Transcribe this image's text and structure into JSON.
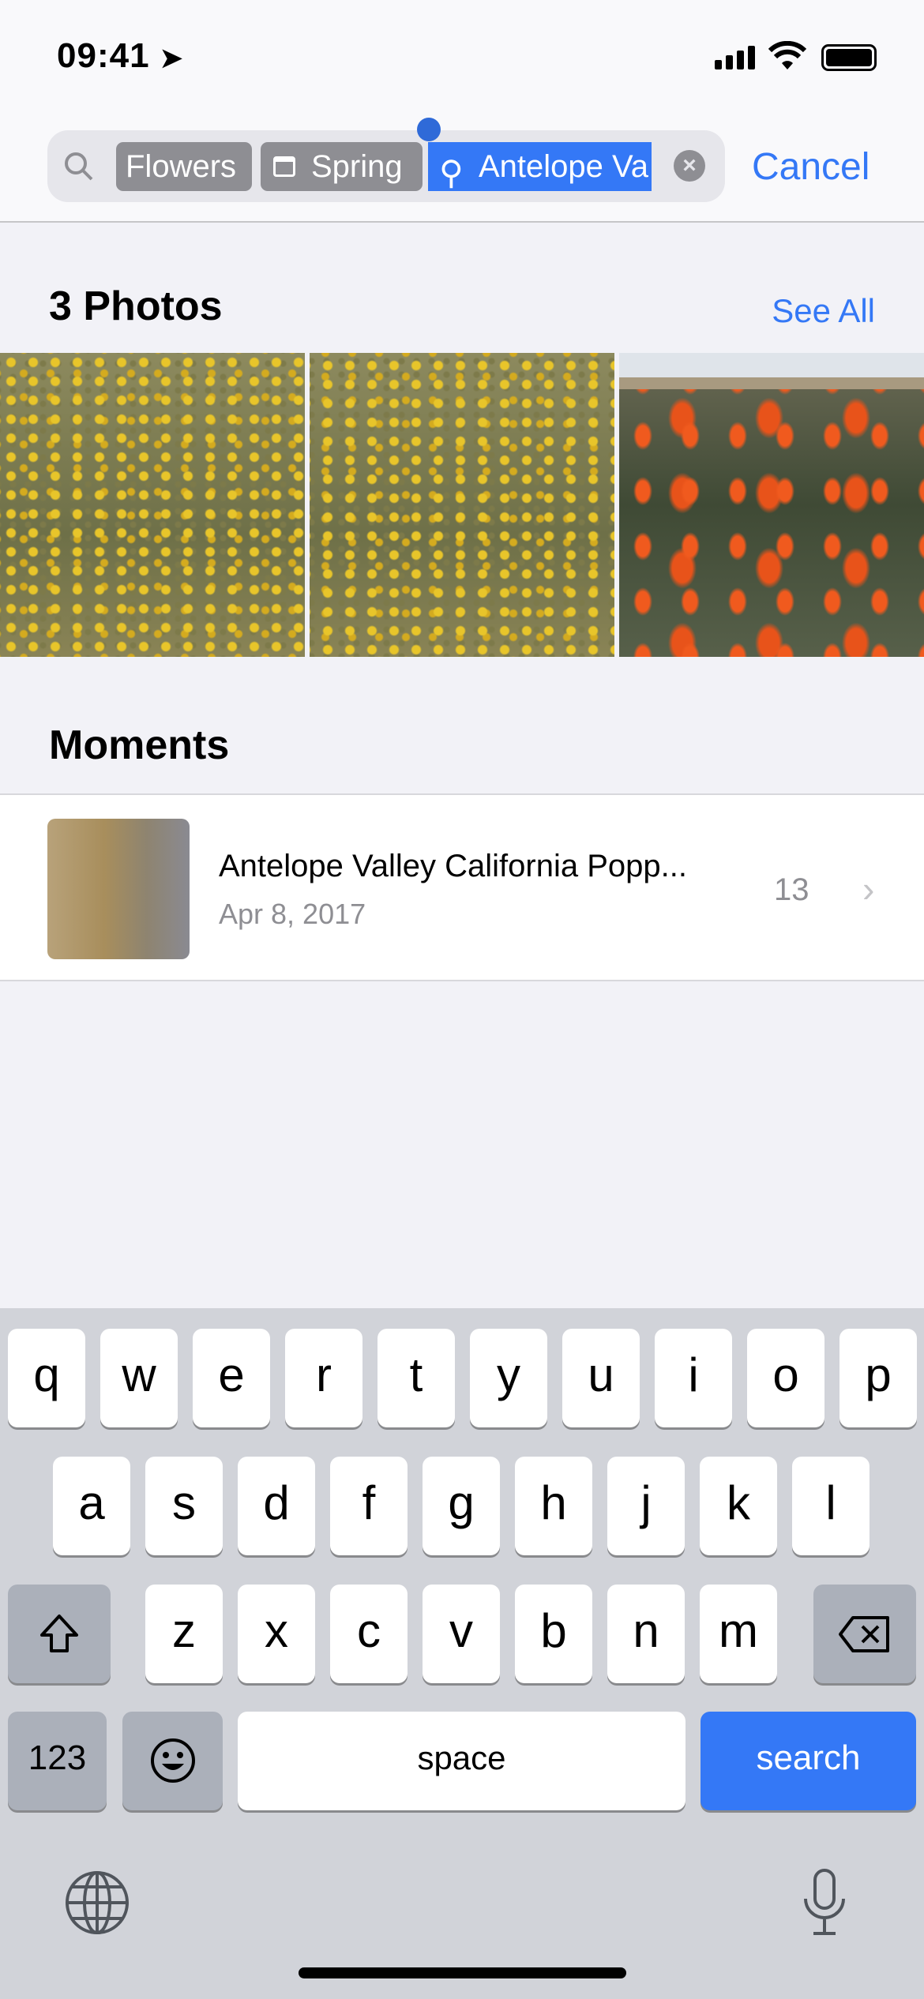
{
  "status_bar": {
    "time": "09:41"
  },
  "search": {
    "tokens": [
      {
        "label": "Flowers",
        "icon": "none"
      },
      {
        "label": "Spring",
        "icon": "calendar-icon"
      },
      {
        "label": "Antelope Va",
        "icon": "location-pin-icon",
        "selected": true
      }
    ],
    "cancel_label": "Cancel"
  },
  "photos": {
    "title": "3 Photos",
    "see_all": "See All",
    "count": 3
  },
  "moments": {
    "title": "Moments",
    "items": [
      {
        "title": "Antelope Valley California Popp...",
        "date": "Apr 8, 2017",
        "count": "13"
      }
    ]
  },
  "keyboard": {
    "row1": [
      "q",
      "w",
      "e",
      "r",
      "t",
      "y",
      "u",
      "i",
      "o",
      "p"
    ],
    "row2": [
      "a",
      "s",
      "d",
      "f",
      "g",
      "h",
      "j",
      "k",
      "l"
    ],
    "row3": [
      "z",
      "x",
      "c",
      "v",
      "b",
      "n",
      "m"
    ],
    "numbers_label": "123",
    "space_label": "space",
    "search_label": "search"
  },
  "colors": {
    "accent": "#3478f6",
    "token": "#8e8e93"
  }
}
